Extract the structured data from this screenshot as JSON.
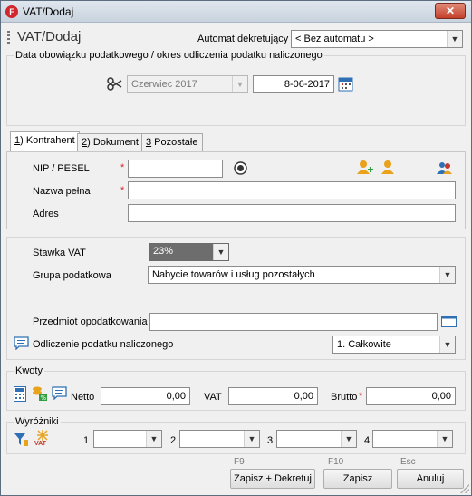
{
  "window": {
    "title": "VAT/Dodaj",
    "app_icon_letter": "F",
    "close_label": "✕"
  },
  "header": {
    "page_title": "VAT/Dodaj",
    "automat_label": "Automat dekretujący",
    "automat_value": "< Bez automatu >"
  },
  "period": {
    "caption": "Data obowiązku podatkowego / okres odliczenia podatku naliczonego",
    "month_value": "Czerwiec 2017",
    "date_value": "8-06-2017"
  },
  "tabs": [
    {
      "key": "1",
      "label": ") Kontrahent"
    },
    {
      "key": "2",
      "label": ") Dokument"
    },
    {
      "key": "3",
      "label": " Pozostałe"
    }
  ],
  "contractor": {
    "nip_label": "NIP / PESEL",
    "nip_value": "",
    "name_label": "Nazwa pełna",
    "name_value": "",
    "address_label": "Adres",
    "address_value": "",
    "required_mark": "*"
  },
  "vat": {
    "rate_label": "Stawka VAT",
    "rate_value": "23%",
    "tax_group_label": "Grupa podatkowa",
    "tax_group_value": "Nabycie towarów i usług pozostałych",
    "subject_label": "Przedmiot opodatkowania",
    "subject_value": "",
    "deduction_label": "Odliczenie podatku naliczonego",
    "deduction_value": "1. Całkowite"
  },
  "amounts": {
    "caption": "Kwoty",
    "netto_label": "Netto",
    "netto_value": "0,00",
    "vat_label": "VAT",
    "vat_value": "0,00",
    "brutto_label": "Brutto",
    "brutto_value": "0,00"
  },
  "markers": {
    "caption": "Wyróżniki",
    "icon_vat_text": "VAT",
    "items": [
      {
        "label": "1",
        "value": ""
      },
      {
        "label": "2",
        "value": ""
      },
      {
        "label": "3",
        "value": ""
      },
      {
        "label": "4",
        "value": ""
      }
    ]
  },
  "footer": {
    "save_dekret_key": "F9",
    "save_dekret_label": "Zapisz + Dekretuj",
    "save_key": "F10",
    "save_label": "Zapisz",
    "cancel_key": "Esc",
    "cancel_label": "Anuluj"
  },
  "colors": {
    "required": "#d0262e",
    "icon_orange": "#e8a21c",
    "icon_blue": "#2f6fb3"
  }
}
